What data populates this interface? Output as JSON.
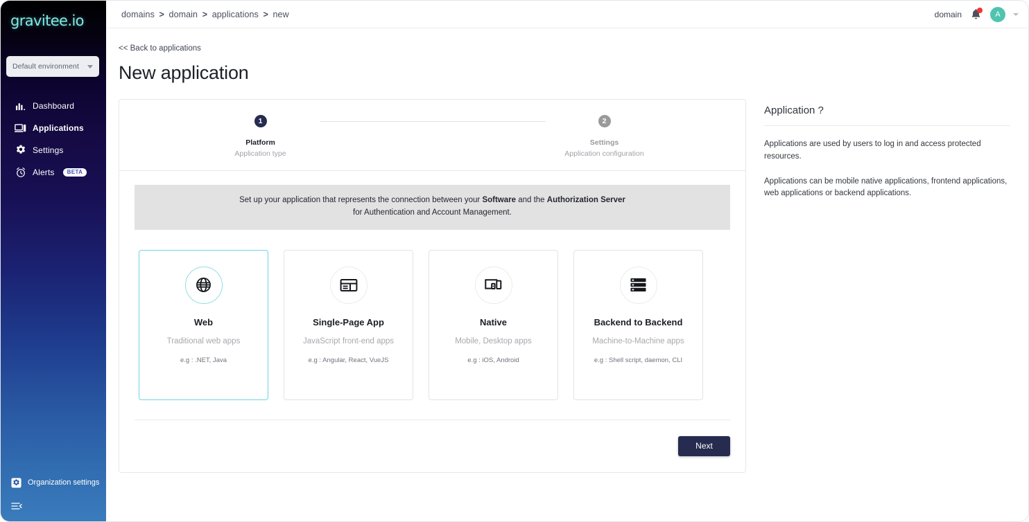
{
  "sidebar": {
    "logo": "gravitee.io",
    "env_selector": {
      "value": "Default environment",
      "caret_icon": "chevron-down-icon"
    },
    "items": [
      {
        "label": "Dashboard",
        "icon": "bar-chart-icon",
        "active": false
      },
      {
        "label": "Applications",
        "icon": "applications-icon",
        "active": true
      },
      {
        "label": "Settings",
        "icon": "gear-icon",
        "active": false
      },
      {
        "label": "Alerts",
        "icon": "alarm-clock-icon",
        "badge": "BETA",
        "active": false
      }
    ],
    "organization_settings": {
      "label": "Organization settings",
      "icon": "gear-square-icon"
    },
    "collapse": {
      "icon": "collapse-menu-icon"
    }
  },
  "topbar": {
    "breadcrumb": [
      "domains",
      "domain",
      "applications",
      "new"
    ],
    "breadcrumb_separator": ">",
    "domain_label": "domain",
    "notification_icon": "bell-icon",
    "notification_dot_color": "#f7322f",
    "avatar_initial": "A",
    "avatar_color": "#4fc4af",
    "caret_icon": "chevron-down-icon"
  },
  "page": {
    "back_link": "<< Back to applications",
    "title": "New application"
  },
  "stepper": {
    "steps": [
      {
        "number": "1",
        "title": "Platform",
        "subtitle": "Application type",
        "state": "active"
      },
      {
        "number": "2",
        "title": "Settings",
        "subtitle": "Application configuration",
        "state": "inactive"
      }
    ]
  },
  "info_banner": {
    "line1_a": "Set up your application that represents the connection between your ",
    "line1_bold1": "Software",
    "line1_b": " and the ",
    "line1_bold2": "Authorization Server",
    "line2": "for Authentication and Account Management."
  },
  "application_types": [
    {
      "name": "Web",
      "description": "Traditional web apps",
      "example": "e.g : .NET, Java",
      "icon": "globe-icon",
      "selected": true
    },
    {
      "name": "Single-Page App",
      "description": "JavaScript front-end apps",
      "example": "e.g : Angular, React, VueJS",
      "icon": "browser-window-icon",
      "selected": false
    },
    {
      "name": "Native",
      "description": "Mobile, Desktop apps",
      "example": "e.g : iOS, Android",
      "icon": "devices-icon",
      "selected": false
    },
    {
      "name": "Backend to Backend",
      "description": "Machine-to-Machine apps",
      "example": "e.g : Shell script, daemon, CLI",
      "icon": "server-stack-icon",
      "selected": false
    }
  ],
  "footer": {
    "next_label": "Next"
  },
  "help": {
    "title": "Application ?",
    "paragraph1": "Applications are used by users to log in and access protected resources.",
    "paragraph2": "Applications can be mobile native applications, frontend applications, web applications or backend applications."
  },
  "colors": {
    "accent_selected": "#6fd6e0",
    "primary_dark": "#262b4f",
    "logo_cyan": "#7fe9e4",
    "banner_bg": "#e2e2e2"
  }
}
